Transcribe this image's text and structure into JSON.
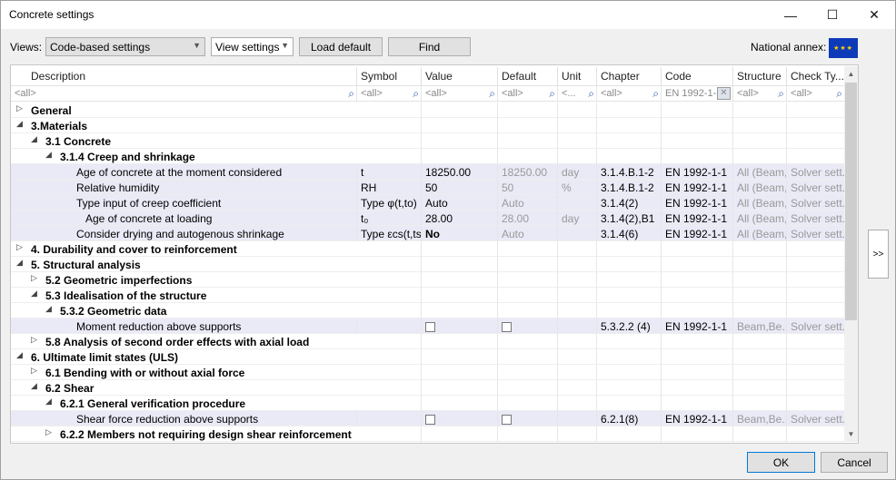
{
  "window": {
    "title": "Concrete settings"
  },
  "toolbar": {
    "views_label": "Views:",
    "views_value": "Code-based settings",
    "view_settings_label": "View settings",
    "load_default_label": "Load default",
    "find_label": "Find",
    "national_annex_label": "National annex:"
  },
  "columns": [
    "Description",
    "Symbol",
    "Value",
    "Default",
    "Unit",
    "Chapter",
    "Code",
    "Structure",
    "Check Ty..."
  ],
  "filters": [
    "<all>",
    "<all>",
    "<all>",
    "<all>",
    "<...",
    "<all>",
    "EN 1992-1-",
    "<all>",
    "<all>"
  ],
  "rows": [
    {
      "type": "group",
      "level": 0,
      "toggle": "▷",
      "label": "General"
    },
    {
      "type": "group",
      "level": 0,
      "toggle": "◢",
      "label": "3.Materials"
    },
    {
      "type": "group",
      "level": 1,
      "toggle": "◢",
      "label": "3.1 Concrete"
    },
    {
      "type": "group",
      "level": 2,
      "toggle": "◢",
      "label": "3.1.4 Creep and shrinkage"
    },
    {
      "type": "data",
      "indent": 0,
      "description": "Age of concrete at the moment considered",
      "symbol": "t",
      "value": "18250.00",
      "default": "18250.00",
      "unit": "day",
      "chapter": "3.1.4.B.1-2",
      "code": "EN 1992-1-1",
      "structure": "All (Beam,...",
      "check": "Solver sett..."
    },
    {
      "type": "data",
      "indent": 0,
      "description": "Relative humidity",
      "symbol": "RH",
      "value": "50",
      "default": "50",
      "unit": "%",
      "chapter": "3.1.4.B.1-2",
      "code": "EN 1992-1-1",
      "structure": "All (Beam,...",
      "check": "Solver sett..."
    },
    {
      "type": "data",
      "indent": 0,
      "description": "Type input of creep coefficient",
      "symbol": "Type φ(t,to)",
      "value": "Auto",
      "default": "Auto",
      "unit": "",
      "chapter": "3.1.4(2)",
      "code": "EN 1992-1-1",
      "structure": "All (Beam,...",
      "check": "Solver sett..."
    },
    {
      "type": "data",
      "indent": 1,
      "description": "Age of concrete at loading",
      "symbol": "t₀",
      "value": "28.00",
      "default": "28.00",
      "unit": "day",
      "chapter": "3.1.4(2),B1",
      "code": "EN 1992-1-1",
      "structure": "All (Beam,...",
      "check": "Solver sett..."
    },
    {
      "type": "data",
      "indent": 0,
      "description": "Consider drying and autogenous shrinkage",
      "symbol": "Type εcs(t,ts)",
      "value": "No",
      "value_bold": true,
      "default": "Auto",
      "unit": "",
      "chapter": "3.1.4(6)",
      "code": "EN 1992-1-1",
      "structure": "All (Beam,...",
      "check": "Solver sett..."
    },
    {
      "type": "group",
      "level": 0,
      "toggle": "▷",
      "label": "4. Durability and cover to reinforcement"
    },
    {
      "type": "group",
      "level": 0,
      "toggle": "◢",
      "label": "5. Structural analysis"
    },
    {
      "type": "group",
      "level": 1,
      "toggle": "▷",
      "label": "5.2 Geometric imperfections"
    },
    {
      "type": "group",
      "level": 1,
      "toggle": "◢",
      "label": "5.3 Idealisation of the structure"
    },
    {
      "type": "group",
      "level": 2,
      "toggle": "◢",
      "label": "5.3.2 Geometric data"
    },
    {
      "type": "data",
      "indent": 0,
      "description": "Moment reduction above supports",
      "symbol": "",
      "value_checkbox": true,
      "default_checkbox": true,
      "unit": "",
      "chapter": "5.3.2.2 (4)",
      "code": "EN 1992-1-1",
      "structure": "Beam,Be...",
      "check": "Solver sett..."
    },
    {
      "type": "group",
      "level": 1,
      "toggle": "▷",
      "label": "5.8 Analysis of second order effects with axial load"
    },
    {
      "type": "group",
      "level": 0,
      "toggle": "◢",
      "label": "6. Ultimate limit states (ULS)"
    },
    {
      "type": "group",
      "level": 1,
      "toggle": "▷",
      "label": "6.1 Bending with or without axial force"
    },
    {
      "type": "group",
      "level": 1,
      "toggle": "◢",
      "label": "6.2 Shear"
    },
    {
      "type": "group",
      "level": 2,
      "toggle": "◢",
      "label": "6.2.1 General verification procedure"
    },
    {
      "type": "data",
      "indent": 0,
      "description": "Shear force reduction above supports",
      "symbol": "",
      "value_checkbox": true,
      "default_checkbox": true,
      "unit": "",
      "chapter": "6.2.1(8)",
      "code": "EN 1992-1-1",
      "structure": "Beam,Be...",
      "check": "Solver sett..."
    },
    {
      "type": "group",
      "level": 2,
      "toggle": "▷",
      "label": "6.2.2 Members not requiring design shear reinforcement"
    }
  ],
  "side": {
    "expand_label": ">>"
  },
  "footer": {
    "ok_label": "OK",
    "cancel_label": "Cancel"
  }
}
